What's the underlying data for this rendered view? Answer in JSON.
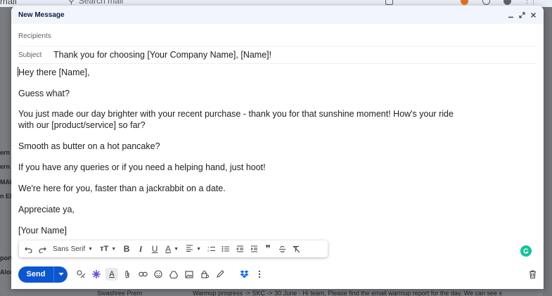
{
  "background": {
    "app_partial": "mail",
    "search_placeholder": "Search mail",
    "left_fragments": [
      "ern",
      "ern",
      "MAIL",
      "n EM",
      "port",
      "Alon"
    ],
    "bottom_row": {
      "sender": "Sivashree Prem",
      "preview": "Warmup progress -> SKC -> 30 June - Hi team, Please find the email warmup report for the day. We can see s"
    }
  },
  "compose": {
    "title": "New Message",
    "recipients_placeholder": "Recipients",
    "subject_label": "Subject",
    "subject": "Thank you for choosing [Your Company Name], [Name]!",
    "body": [
      "Hey there [Name],",
      "Guess what?",
      "You just made our day brighter with your recent purchase - thank you for that sunshine moment! How's your ride",
      "with our [product/service] so far?",
      "Smooth as butter on a hot pancake?",
      "If you have any queries or if you need a helping hand, just hoot!",
      "We're here for you, faster than a jackrabbit on a date.",
      "Appreciate ya,",
      "[Your Name]"
    ],
    "toolbar": {
      "font": "Sans Serif"
    },
    "send_label": "Send"
  },
  "colors": {
    "accent": "#0b57d0",
    "header_bg": "#f2f6fc",
    "grammarly": "#15c39a",
    "dropbox": "#0061ff"
  },
  "icons": [
    "undo-icon",
    "redo-icon",
    "font-size-icon",
    "bold-icon",
    "italic-icon",
    "underline-icon",
    "text-color-icon",
    "align-icon",
    "numbered-list-icon",
    "bulleted-list-icon",
    "indent-less-icon",
    "indent-more-icon",
    "quote-icon",
    "strikethrough-icon",
    "remove-formatting-icon",
    "minimize-icon",
    "popout-icon",
    "close-icon",
    "grammarly-icon",
    "formatting-options-icon",
    "ai-sparkle-icon",
    "attach-icon",
    "link-icon",
    "emoji-icon",
    "drive-icon",
    "photo-icon",
    "confidential-icon",
    "signature-icon",
    "dropbox-icon",
    "more-options-icon",
    "trash-icon"
  ]
}
